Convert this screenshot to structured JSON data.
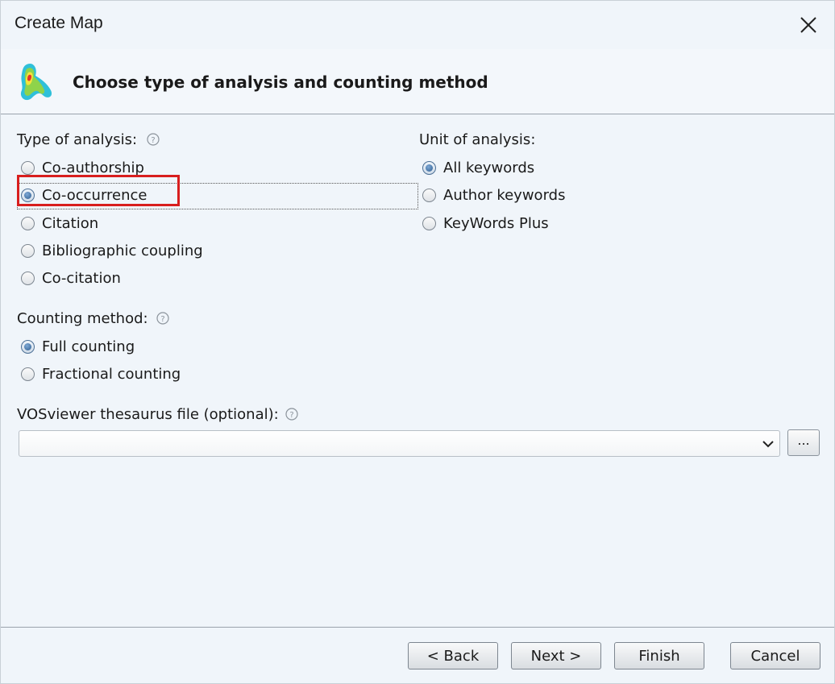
{
  "window": {
    "title": "Create Map"
  },
  "header": {
    "title": "Choose type of analysis and counting method",
    "icon": "vosviewer-logo-icon"
  },
  "type_of_analysis": {
    "label": "Type of analysis:",
    "options": [
      {
        "label": "Co-authorship",
        "checked": false
      },
      {
        "label": "Co-occurrence",
        "checked": true
      },
      {
        "label": "Citation",
        "checked": false
      },
      {
        "label": "Bibliographic coupling",
        "checked": false
      },
      {
        "label": "Co-citation",
        "checked": false
      }
    ]
  },
  "unit_of_analysis": {
    "label": "Unit of analysis:",
    "options": [
      {
        "label": "All keywords",
        "checked": true
      },
      {
        "label": "Author keywords",
        "checked": false
      },
      {
        "label": "KeyWords Plus",
        "checked": false
      }
    ]
  },
  "counting_method": {
    "label": "Counting method:",
    "options": [
      {
        "label": "Full counting",
        "checked": true
      },
      {
        "label": "Fractional counting",
        "checked": false
      }
    ]
  },
  "thesaurus": {
    "label": "VOSviewer thesaurus file (optional):",
    "value": "",
    "browse_label": "..."
  },
  "footer": {
    "back_label": "< Back",
    "next_label": "Next >",
    "finish_label": "Finish",
    "cancel_label": "Cancel"
  },
  "colors": {
    "highlight": "#d81e1e",
    "background": "#f0f5fa"
  }
}
